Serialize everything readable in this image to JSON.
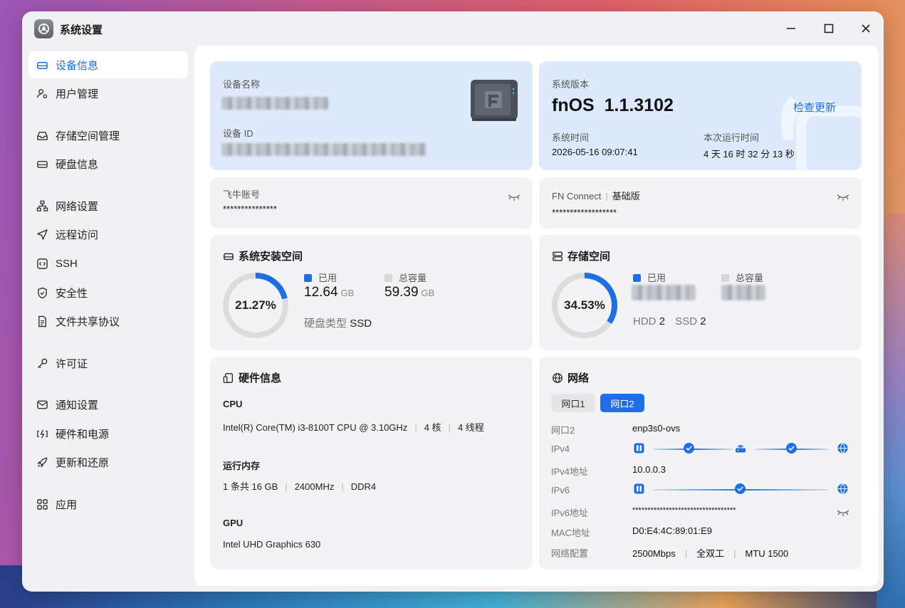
{
  "app": {
    "title": "系统设置"
  },
  "sidebar": {
    "items": [
      {
        "label": "设备信息"
      },
      {
        "label": "用户管理"
      },
      {
        "label": "存储空间管理"
      },
      {
        "label": "硬盘信息"
      },
      {
        "label": "网络设置"
      },
      {
        "label": "远程访问"
      },
      {
        "label": "SSH"
      },
      {
        "label": "安全性"
      },
      {
        "label": "文件共享协议"
      },
      {
        "label": "许可证"
      },
      {
        "label": "通知设置"
      },
      {
        "label": "硬件和电源"
      },
      {
        "label": "更新和还原"
      },
      {
        "label": "应用"
      }
    ]
  },
  "device": {
    "name_label": "设备名称",
    "id_label": "设备 ID"
  },
  "system": {
    "version_label": "系统版本",
    "version": "fnOS  1.1.3102",
    "check_update": "检查更新",
    "time_label": "系统时间",
    "time": "2026-05-16 09:07:41",
    "uptime_label": "本次运行时间",
    "uptime": "4 天 16 时 32 分 13 秒"
  },
  "account": {
    "label": "飞牛账号",
    "value": "***************"
  },
  "fnconnect": {
    "label": "FN Connect",
    "tier": "基础版",
    "value": "******************"
  },
  "sys_storage": {
    "title": "系统安装空间",
    "percent_text": "21.27%",
    "percent": 0.2127,
    "used_label": "已用",
    "used": "12.64",
    "total_label": "总容量",
    "total": "59.39",
    "unit": "GB",
    "disk_type_label": "硬盘类型",
    "disk_type": "SSD"
  },
  "storage": {
    "title": "存储空间",
    "percent_text": "34.53%",
    "percent": 0.3453,
    "used_label": "已用",
    "total_label": "总容量",
    "hdd_label": "HDD",
    "hdd": "2",
    "ssd_label": "SSD",
    "ssd": "2"
  },
  "hardware": {
    "title": "硬件信息",
    "cpu_label": "CPU",
    "cpu_model": "Intel(R) Core(TM) i3-8100T CPU @ 3.10GHz",
    "cpu_cores": "4 核",
    "cpu_threads": "4 线程",
    "mem_label": "运行内存",
    "mem_size": "1 条共 16 GB",
    "mem_freq": "2400MHz",
    "mem_type": "DDR4",
    "gpu_label": "GPU",
    "gpu_model": "Intel UHD Graphics 630"
  },
  "network": {
    "title": "网络",
    "tabs": [
      "网口1",
      "网口2"
    ],
    "rows": {
      "port_label": "网口2",
      "port_value": "enp3s0-ovs",
      "ipv4_label": "IPv4",
      "ipv4_addr_label": "IPv4地址",
      "ipv4_addr": "10.0.0.3",
      "ipv6_label": "IPv6",
      "ipv6_addr_label": "IPv6地址",
      "ipv6_addr": "**********************************",
      "mac_label": "MAC地址",
      "mac": "D0:E4:4C:89:01:E9",
      "config_label": "网络配置",
      "speed": "2500Mbps",
      "duplex": "全双工",
      "mtu": "MTU 1500"
    }
  },
  "colors": {
    "accent": "#1e6ee6",
    "card": "#f3f3f5",
    "card_blue": "#deeafc"
  }
}
